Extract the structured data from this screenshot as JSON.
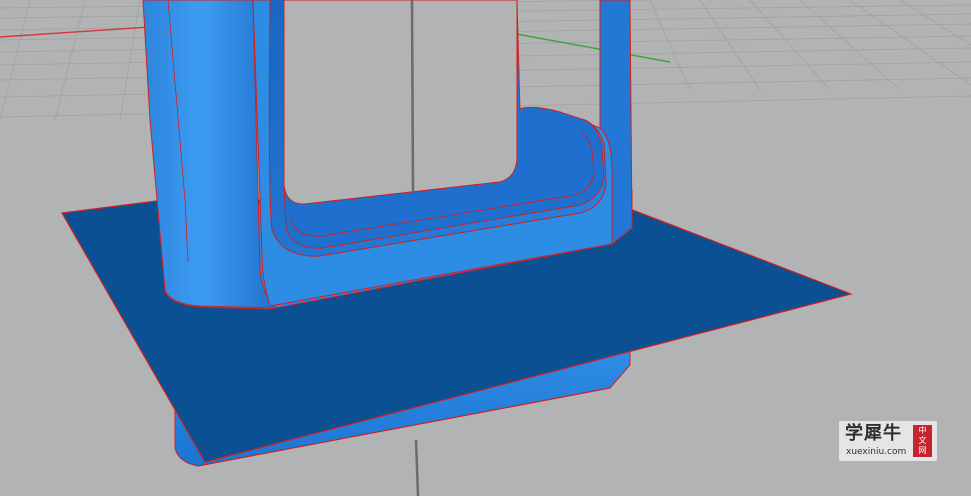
{
  "viewport": {
    "label": "3D perspective viewport",
    "background_color": "#b2b3b4",
    "grid_color": "#a0a1a3",
    "axis_x_color": "#d43a3a",
    "axis_y_color": "#3fa33f",
    "axis_z_color": "#6b6b6b",
    "model_color": "#2f8fe6",
    "model_shade_color": "#1c6fd0",
    "plane_color": "#0c5094",
    "edge_color": "#d02020"
  },
  "watermark": {
    "chinese_text": "学犀牛",
    "badge_chars": [
      "中",
      "文",
      "网"
    ],
    "url_text": "xuexiniu.com"
  }
}
